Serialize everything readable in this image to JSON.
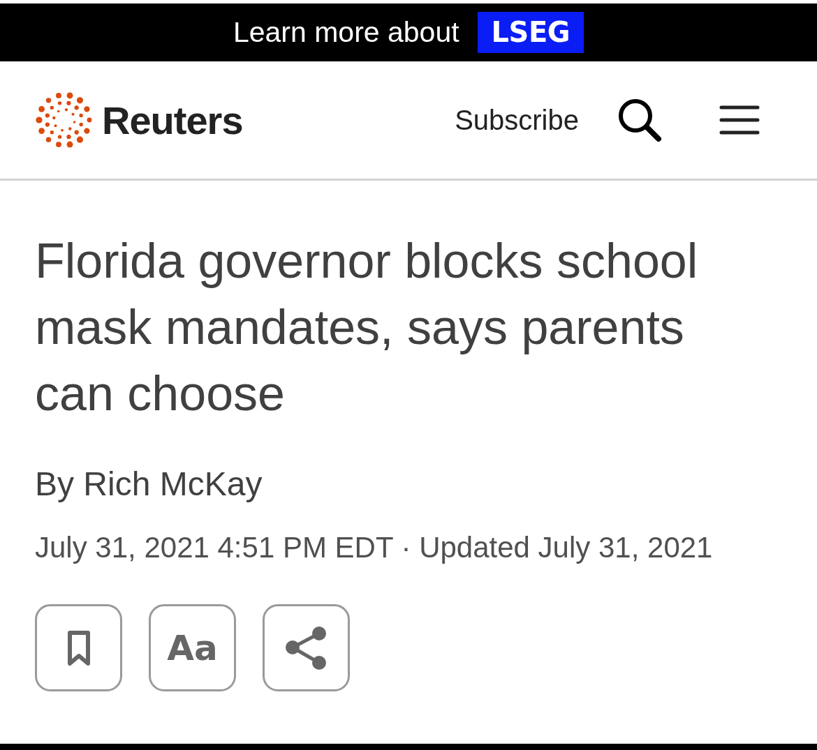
{
  "promo_banner": {
    "text": "Learn more about",
    "badge": "LSEG"
  },
  "header": {
    "logo_text": "Reuters",
    "subscribe": "Subscribe"
  },
  "article": {
    "headline": "Florida governor blocks school mask mandates, says parents can choose",
    "byline": "By Rich McKay",
    "dateline": "July 31, 2021 4:51 PM EDT · Updated July 31, 2021"
  },
  "actions": [
    {
      "kind": "bookmark"
    },
    {
      "kind": "text_size",
      "label": "Aa"
    },
    {
      "kind": "share"
    }
  ]
}
